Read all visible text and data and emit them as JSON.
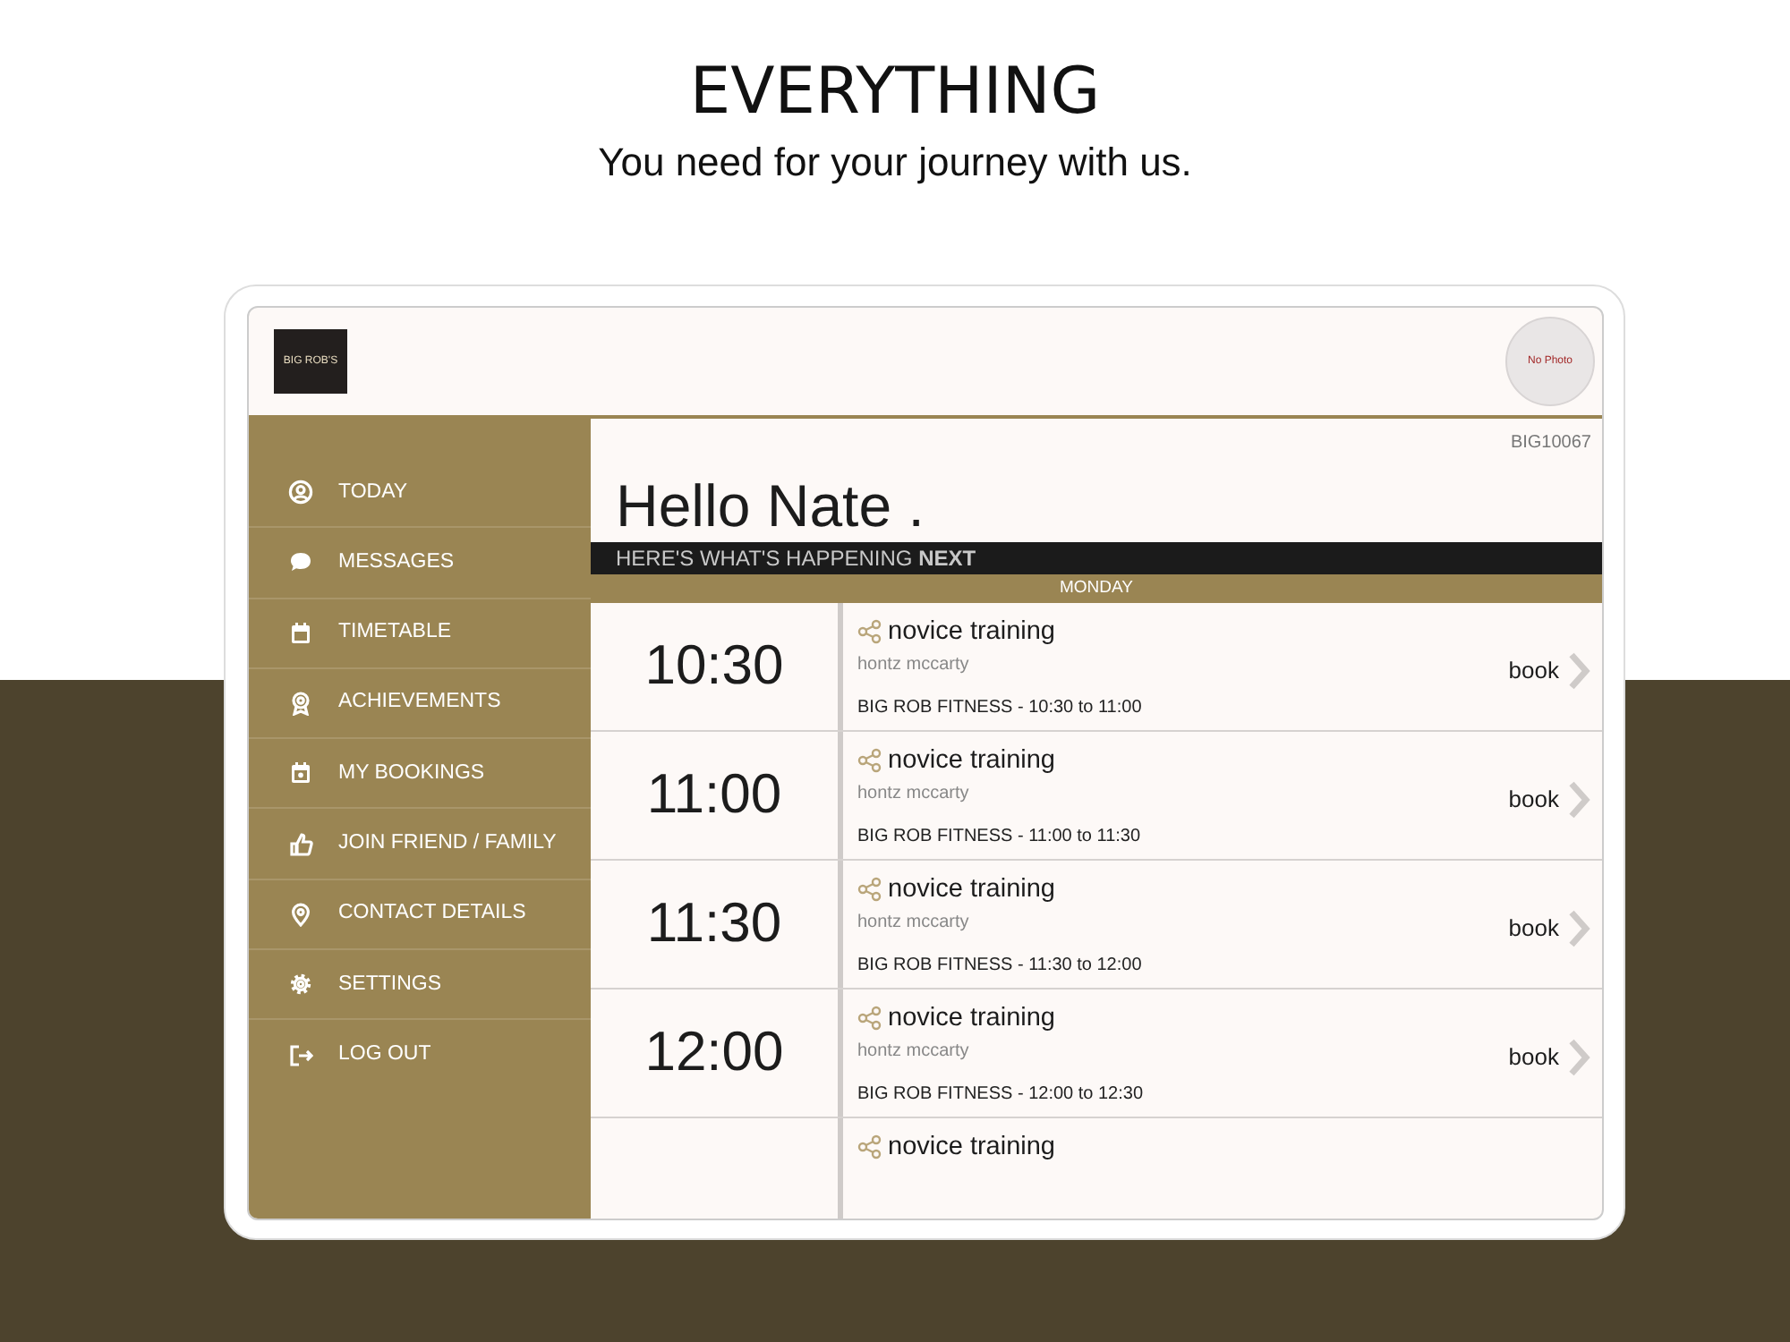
{
  "headline": {
    "title": "EVERYTHING",
    "subtitle": "You need for your journey with us."
  },
  "app": {
    "logo_text": "BIG ROB'S",
    "avatar_text": "No Photo",
    "member_id": "BIG10067",
    "greeting": "Hello Nate .",
    "sidebar": {
      "items": [
        {
          "label": "TODAY"
        },
        {
          "label": "MESSAGES"
        },
        {
          "label": "TIMETABLE"
        },
        {
          "label": "ACHIEVEMENTS"
        },
        {
          "label": "MY BOOKINGS"
        },
        {
          "label": "JOIN FRIEND / FAMILY"
        },
        {
          "label": "CONTACT DETAILS"
        },
        {
          "label": "SETTINGS"
        },
        {
          "label": "LOG OUT"
        }
      ]
    },
    "banner": {
      "text": "HERE'S WHAT'S HAPPENING **NEXT**"
    },
    "day": "MONDAY",
    "classes": [
      {
        "time": "10:30",
        "title": "novice training",
        "instructor": "hontz mccarty",
        "detail": "BIG ROB FITNESS - 10:30 to 11:00",
        "action": "book"
      },
      {
        "time": "11:00",
        "title": "novice training",
        "instructor": "hontz mccarty",
        "detail": "BIG ROB FITNESS - 11:00 to 11:30",
        "action": "book"
      },
      {
        "time": "11:30",
        "title": "novice training",
        "instructor": "hontz mccarty",
        "detail": "BIG ROB FITNESS - 11:30 to 12:00",
        "action": "book"
      },
      {
        "time": "12:00",
        "title": "novice training",
        "instructor": "hontz mccarty",
        "detail": "BIG ROB FITNESS - 12:00 to 12:30",
        "action": "book"
      },
      {
        "title": "novice training"
      }
    ]
  }
}
